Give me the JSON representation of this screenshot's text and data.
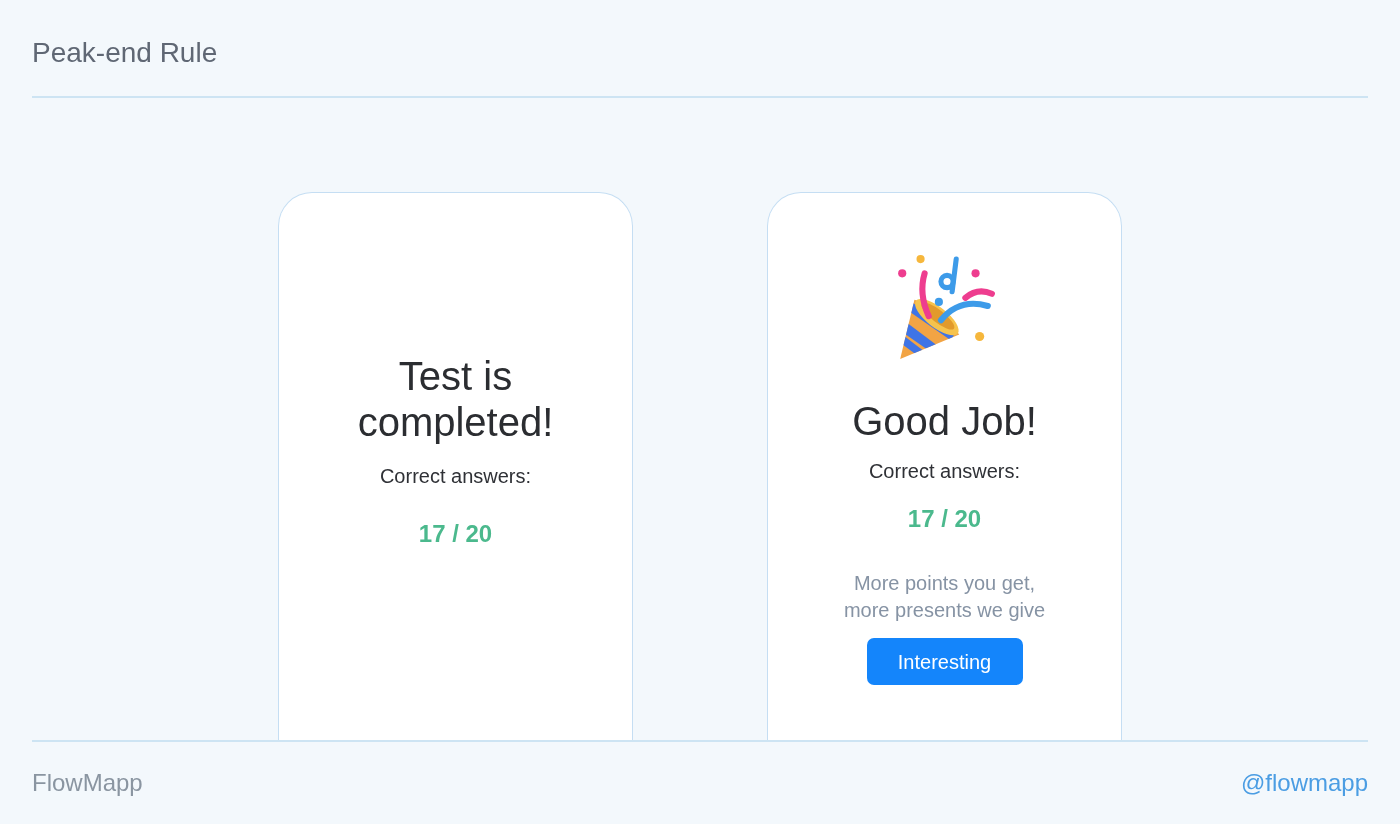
{
  "header": {
    "title": "Peak-end Rule"
  },
  "cards": [
    {
      "kind": "plain",
      "title": "Test is completed!",
      "label": "Correct answers:",
      "score": "17 / 20"
    },
    {
      "kind": "celebration",
      "title": "Good Job!",
      "label": "Correct answers:",
      "score": "17 / 20",
      "message_lines": [
        "More points you get,",
        "more presents we give"
      ],
      "button": "Interesting"
    }
  ],
  "footer": {
    "brand": "FlowMapp",
    "handle": "@flowmapp"
  }
}
